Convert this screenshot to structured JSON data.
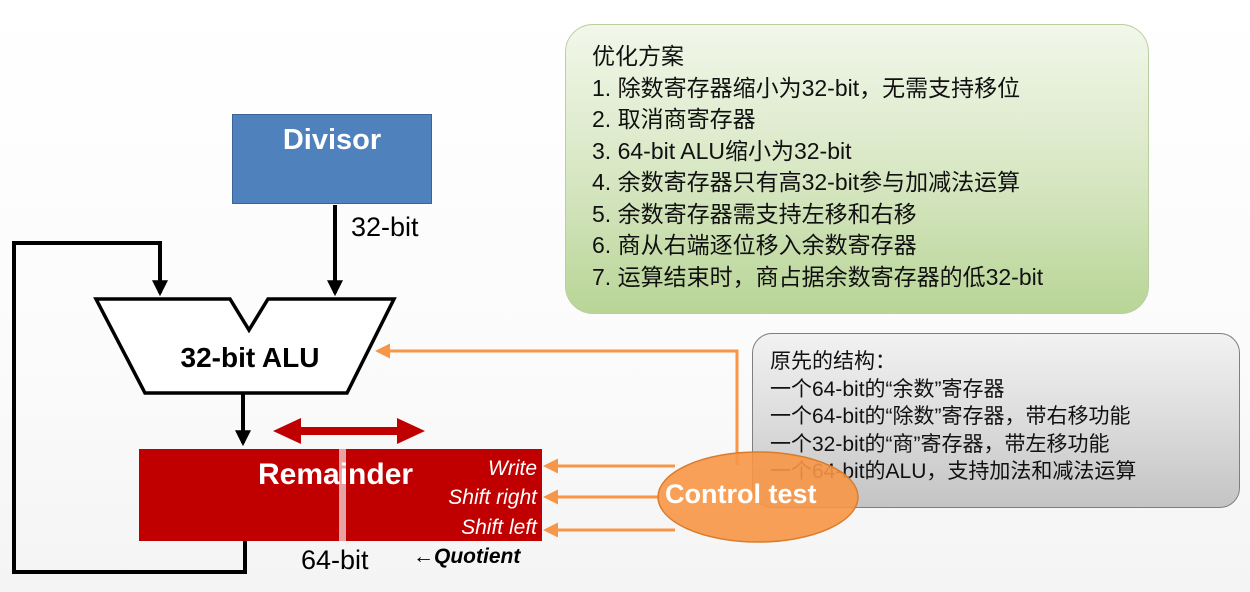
{
  "divisor": {
    "label": "Divisor",
    "width": "32-bit"
  },
  "alu": {
    "label": "32-bit ALU"
  },
  "remainder": {
    "label": "Remainder",
    "width": "64-bit",
    "signals": {
      "write": "Write",
      "shift_right": "Shift right",
      "shift_left": "Shift left"
    },
    "quotient_arrow": "←",
    "quotient_label": "Quotient"
  },
  "control": {
    "label": "Control test"
  },
  "optimization_panel": {
    "title": "优化方案",
    "items": [
      "1. 除数寄存器缩小为32-bit，无需支持移位",
      "2. 取消商寄存器",
      "3. 64-bit ALU缩小为32-bit",
      "4. 余数寄存器只有高32-bit参与加减法运算",
      "5. 余数寄存器需支持左移和右移",
      "6. 商从右端逐位移入余数寄存器",
      "7. 运算结束时，商占据余数寄存器的低32-bit"
    ]
  },
  "original_panel": {
    "title": "原先的结构：",
    "items": [
      "一个64-bit的“余数”寄存器",
      "一个64-bit的“除数”寄存器，带右移功能",
      "一个32-bit的“商”寄存器，带左移功能",
      "一个64-bit的ALU，支持加法和减法运算"
    ]
  },
  "colors": {
    "divisor_fill": "#4f81bd",
    "remainder_fill": "#c00000",
    "double_arrow": "#c00000",
    "control_fill": "#f79646",
    "control_arrows": "#f79646",
    "optimization_panel_fill": "#c5dea6",
    "original_panel_fill": "#d9d9d9"
  }
}
